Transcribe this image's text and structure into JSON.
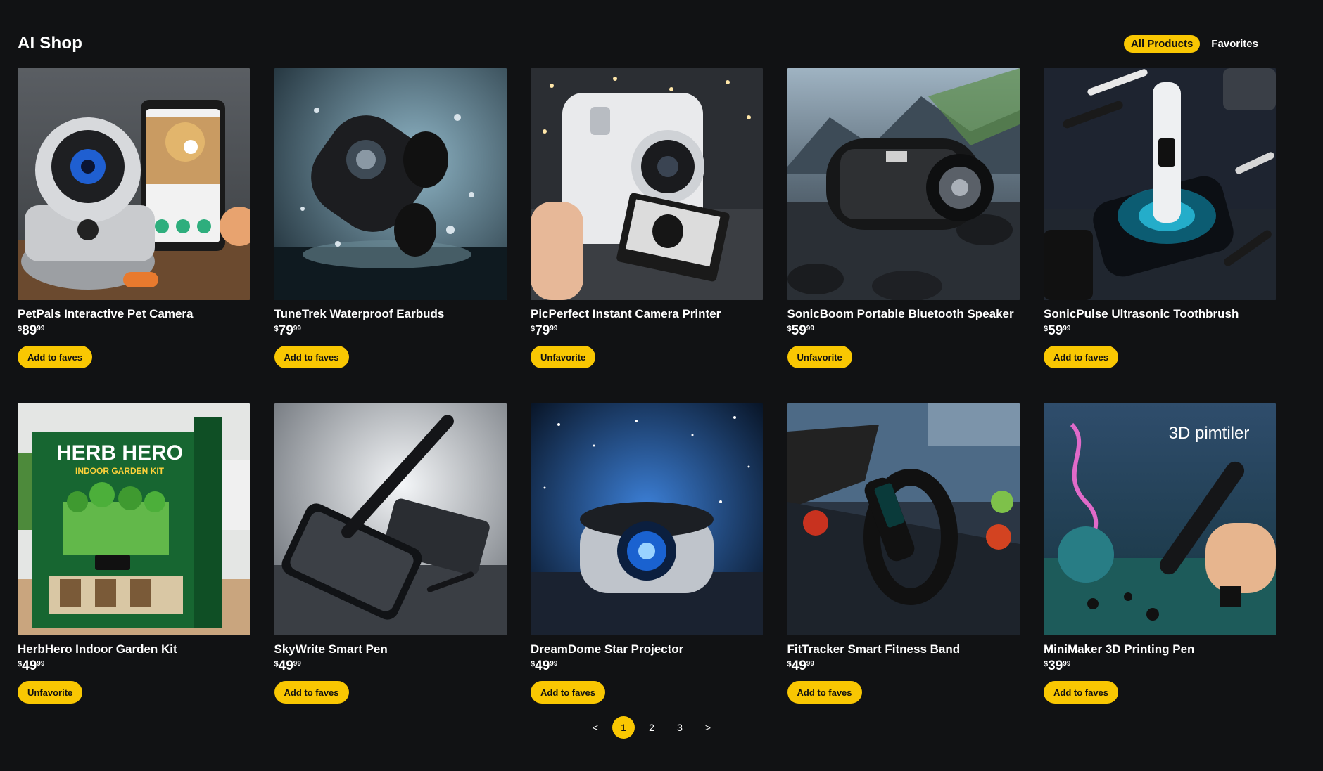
{
  "header": {
    "title": "AI Shop",
    "nav": [
      {
        "label": "All Products",
        "active": true
      },
      {
        "label": "Favorites",
        "active": false
      }
    ]
  },
  "products": [
    {
      "name": "PetPals Interactive Pet Camera",
      "currency": "$",
      "dollars": "89",
      "cents": "99",
      "button": "Add to faves"
    },
    {
      "name": "TuneTrek Waterproof Earbuds",
      "currency": "$",
      "dollars": "79",
      "cents": "99",
      "button": "Add to faves"
    },
    {
      "name": "PicPerfect Instant Camera Printer",
      "currency": "$",
      "dollars": "79",
      "cents": "99",
      "button": "Unfavorite"
    },
    {
      "name": "SonicBoom Portable Bluetooth Speaker",
      "currency": "$",
      "dollars": "59",
      "cents": "99",
      "button": "Unfavorite"
    },
    {
      "name": "SonicPulse Ultrasonic Toothbrush",
      "currency": "$",
      "dollars": "59",
      "cents": "99",
      "button": "Add to faves"
    },
    {
      "name": "HerbHero Indoor Garden Kit",
      "currency": "$",
      "dollars": "49",
      "cents": "99",
      "button": "Unfavorite"
    },
    {
      "name": "SkyWrite Smart Pen",
      "currency": "$",
      "dollars": "49",
      "cents": "99",
      "button": "Add to faves"
    },
    {
      "name": "DreamDome Star Projector",
      "currency": "$",
      "dollars": "49",
      "cents": "99",
      "button": "Add to faves"
    },
    {
      "name": "FitTracker Smart Fitness Band",
      "currency": "$",
      "dollars": "49",
      "cents": "99",
      "button": "Add to faves"
    },
    {
      "name": "MiniMaker 3D Printing Pen",
      "currency": "$",
      "dollars": "39",
      "cents": "99",
      "button": "Add to faves"
    }
  ],
  "image_text": {
    "herbhero_title": "HERB HERO",
    "herbhero_sub": "INDOOR GARDEN KIT",
    "minimaker_title": "3D pimtiler"
  },
  "pagination": {
    "prev": "<",
    "pages": [
      "1",
      "2",
      "3"
    ],
    "active": "1",
    "next": ">"
  },
  "colors": {
    "background": "#111214",
    "accent": "#f9c702",
    "text": "#ffffff"
  }
}
